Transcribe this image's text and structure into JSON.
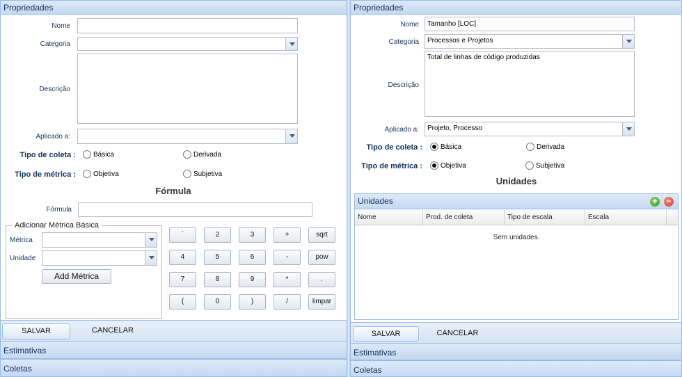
{
  "left": {
    "header": "Propriedades",
    "labels": {
      "nome": "Nome",
      "categoria": "Categoria",
      "descricao": "Descrição",
      "aplicado": "Aplicado a:",
      "tipo_coleta": "Tipo de coleta :",
      "tipo_metrica": "Tipo de métrica :",
      "formula": "Fórmula"
    },
    "values": {
      "nome": "",
      "categoria": "",
      "descricao": "",
      "aplicado": "",
      "formula": ""
    },
    "radios": {
      "basica": "Básica",
      "derivada": "Derivada",
      "objetiva": "Objetiva",
      "subjetiva": "Subjetiva"
    },
    "formula_title": "Fórmula",
    "fieldset": {
      "legend": "Adicionar Métrica Básica",
      "metrica_label": "Métrica",
      "unidade_label": "Unidade",
      "metrica_value": "",
      "unidade_value": "",
      "add_button": "Add Métrica"
    },
    "calc_keys": [
      [
        "´",
        "2",
        "3",
        "+",
        "sqrt"
      ],
      [
        "4",
        "5",
        "6",
        "-",
        "pow"
      ],
      [
        "7",
        "8",
        "9",
        "*",
        "."
      ],
      [
        "(",
        "0",
        ")",
        "/",
        "limpar"
      ]
    ],
    "save": "SALVAR",
    "cancel": "CANCELAR",
    "estimativas": "Estimativas",
    "coletas": "Coletas"
  },
  "right": {
    "header": "Propriedades",
    "labels": {
      "nome": "Nome",
      "categoria": "Categoria",
      "descricao": "Descrição",
      "aplicado": "Aplicado a:",
      "tipo_coleta": "Tipo de coleta :",
      "tipo_metrica": "Tipo de métrica :"
    },
    "values": {
      "nome": "Tamanho [LOC]",
      "categoria": "Processos e Projetos",
      "descricao": "Total de linhas de código produzidas",
      "aplicado": "Projeto, Processo"
    },
    "radios": {
      "basica": "Básica",
      "derivada": "Derivada",
      "objetiva": "Objetiva",
      "subjetiva": "Subjetiva"
    },
    "selected": {
      "tipo_coleta": "Básica",
      "tipo_metrica": "Objetiva"
    },
    "unidades_title": "Unidades",
    "grid": {
      "title": "Unidades",
      "columns": [
        "Nome",
        "Prod. de coleta",
        "Tipo de escala",
        "Escala"
      ],
      "empty_text": "Sem unidades."
    },
    "save": "SALVAR",
    "cancel": "CANCELAR",
    "estimativas": "Estimativas",
    "coletas": "Coletas"
  }
}
